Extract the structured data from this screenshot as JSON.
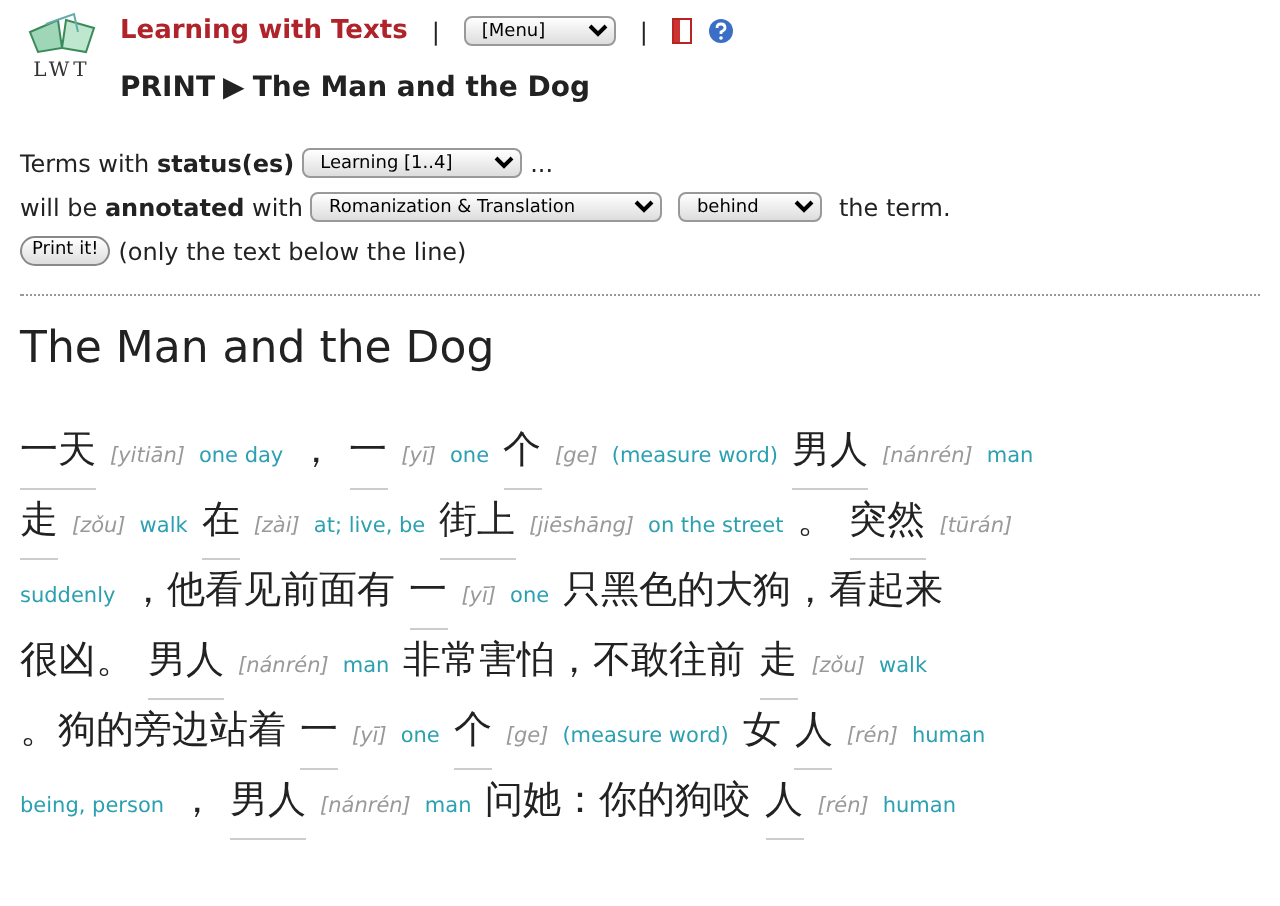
{
  "header": {
    "logo_text": "LWT",
    "app_title": "Learning with Texts",
    "separator_1": "|",
    "menu_select": "[Menu]",
    "separator_2": "|"
  },
  "page_title": {
    "prefix": "PRINT",
    "arrow": "▶",
    "title": "The Man and the Dog"
  },
  "form": {
    "status_line": {
      "text": "Terms with **status(es)**",
      "select": "Learning [1..4]",
      "suffix": "..."
    },
    "annotate_line": {
      "text": "will be **annotated** with",
      "select": "Romanization & Translation",
      "position_select": "behind",
      "suffix": "the term."
    },
    "print_button": "Print it!",
    "print_note": "(only the text below the line)"
  },
  "text": {
    "title": "The Man and the Dog",
    "lines": [
      [
        {
          "kind": "term",
          "word": "一天",
          "romanization": "[yitiān]",
          "translation": "one day"
        },
        {
          "kind": "plain",
          "text": "，"
        },
        {
          "kind": "term",
          "word": "一",
          "romanization": "[yī]",
          "translation": "one"
        },
        {
          "kind": "term",
          "word": "个",
          "romanization": "[ge]",
          "translation": "(measure word)"
        },
        {
          "kind": "term",
          "word": "男人",
          "romanization": "[nánrén]",
          "translation": "man"
        }
      ],
      [
        {
          "kind": "term",
          "word": "走",
          "romanization": "[zǒu]",
          "translation": "walk"
        },
        {
          "kind": "term",
          "word": "在",
          "romanization": "[zài]",
          "translation": "at; live, be"
        },
        {
          "kind": "term",
          "word": "街上",
          "romanization": "[jiēshāng]",
          "translation": "on the street"
        },
        {
          "kind": "plain",
          "text": "。"
        },
        {
          "kind": "term",
          "word": "突然",
          "romanization": "[tūrán]"
        }
      ],
      [
        {
          "kind": "translation",
          "text": "suddenly"
        },
        {
          "kind": "plain",
          "text": "，他看见前面有"
        },
        {
          "kind": "term",
          "word": "一",
          "romanization": "[yī]",
          "translation": "one"
        },
        {
          "kind": "plain",
          "text": "只黑色的大狗，看起来"
        }
      ],
      [
        {
          "kind": "plain",
          "text": "很凶。"
        },
        {
          "kind": "term",
          "word": "男人",
          "romanization": "[nánrén]",
          "translation": "man"
        },
        {
          "kind": "plain",
          "text": "非常害怕，不敢往前"
        },
        {
          "kind": "term",
          "word": "走",
          "romanization": "[zǒu]",
          "translation": "walk"
        }
      ],
      [
        {
          "kind": "plain",
          "text": "。狗的旁边站着"
        },
        {
          "kind": "term",
          "word": "一",
          "romanization": "[yī]",
          "translation": "one"
        },
        {
          "kind": "term",
          "word": "个",
          "romanization": "[ge]",
          "translation": "(measure word)"
        },
        {
          "kind": "plain",
          "text": "女"
        },
        {
          "kind": "term",
          "word": "人",
          "romanization": "[rén]",
          "translation": "human"
        }
      ],
      [
        {
          "kind": "translation",
          "text": "being, person"
        },
        {
          "kind": "plain",
          "text": "，"
        },
        {
          "kind": "term",
          "word": "男人",
          "romanization": "[nánrén]",
          "translation": "man"
        },
        {
          "kind": "plain",
          "text": "问她：你的狗咬"
        },
        {
          "kind": "term",
          "word": "人",
          "romanization": "[rén]",
          "translation": "human"
        }
      ]
    ]
  }
}
